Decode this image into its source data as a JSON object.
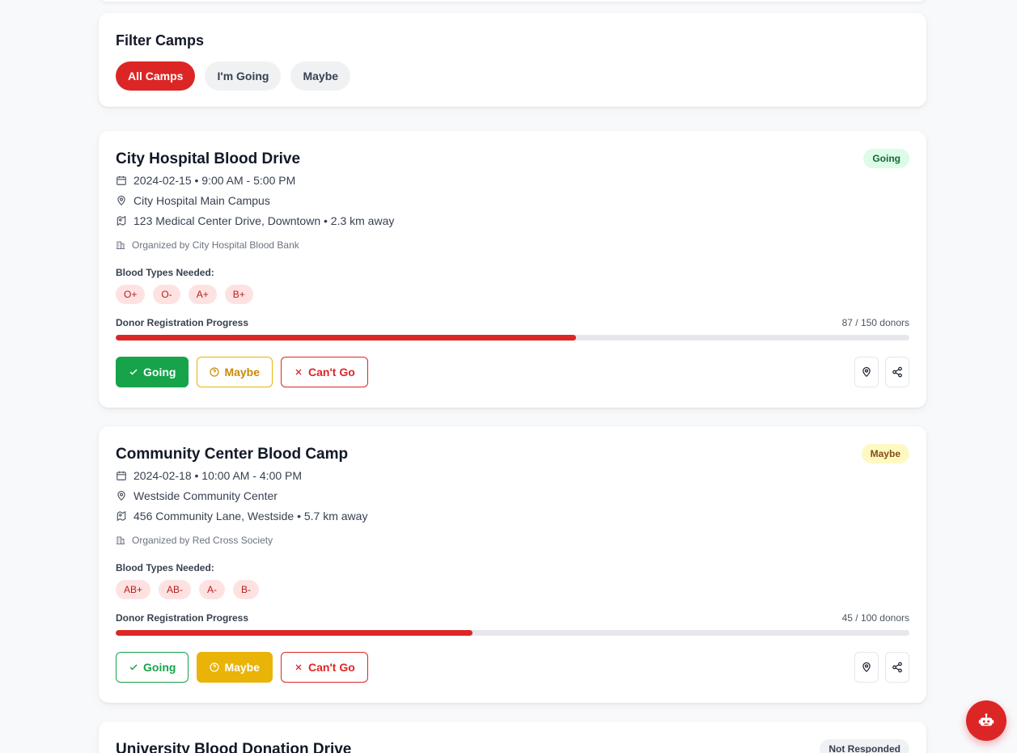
{
  "filter": {
    "title": "Filter Camps",
    "options": [
      "All Camps",
      "I'm Going",
      "Maybe"
    ],
    "active_index": 0
  },
  "colors": {
    "accent": "#dc2626",
    "going": "#16a34a",
    "maybe": "#eab308"
  },
  "camps": [
    {
      "title": "City Hospital Blood Drive",
      "status": "Going",
      "datetime": "2024-02-15 • 9:00 AM - 5:00 PM",
      "venue": "City Hospital Main Campus",
      "address": "123 Medical Center Drive, Downtown • 2.3 km away",
      "organizer": "Organized by City Hospital Blood Bank",
      "blood_types_label": "Blood Types Needed:",
      "blood_types": [
        "O+",
        "O-",
        "A+",
        "B+"
      ],
      "progress_label": "Donor Registration Progress",
      "progress_text": "87 / 150 donors",
      "progress_fraction": 0.58,
      "buttons": {
        "going": "Going",
        "maybe": "Maybe",
        "cant": "Can't Go"
      },
      "selected": "going"
    },
    {
      "title": "Community Center Blood Camp",
      "status": "Maybe",
      "datetime": "2024-02-18 • 10:00 AM - 4:00 PM",
      "venue": "Westside Community Center",
      "address": "456 Community Lane, Westside • 5.7 km away",
      "organizer": "Organized by Red Cross Society",
      "blood_types_label": "Blood Types Needed:",
      "blood_types": [
        "AB+",
        "AB-",
        "A-",
        "B-"
      ],
      "progress_label": "Donor Registration Progress",
      "progress_text": "45 / 100 donors",
      "progress_fraction": 0.45,
      "buttons": {
        "going": "Going",
        "maybe": "Maybe",
        "cant": "Can't Go"
      },
      "selected": "maybe"
    },
    {
      "title": "University Blood Donation Drive",
      "status": "Not Responded"
    }
  ],
  "icons": {
    "date": "calendar-icon",
    "venue": "map-pin-icon",
    "address": "map-icon",
    "organizer": "building-icon",
    "location_button": "map-pin-icon",
    "share_button": "share-icon",
    "fab": "robot-icon"
  }
}
